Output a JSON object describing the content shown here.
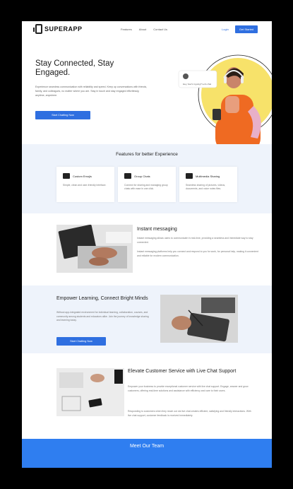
{
  "nav": {
    "logo": "SUPERAPP",
    "links": [
      "Features",
      "About",
      "Contact Us"
    ],
    "login": "Login",
    "signup": "Get Started"
  },
  "hero": {
    "title": "Stay Connected, Stay Engaged.",
    "description": "Experience seamless communication with reliability and speed. Keep up conversations with friends, family, and colleagues, no matter where you are. Stay in touch and stay engaged effortlessly, anytime, anywhere.",
    "button": "Start Chatting Now",
    "chat_bubble": "Hey, how's it going? Let's chat"
  },
  "features": {
    "title": "Features for better Experience",
    "cards": [
      {
        "title": "Custom Emojis",
        "text": "Simple, clean and user-friendly interface."
      },
      {
        "title": "Group Chats",
        "text": "Connect for sharing and managing group chats with ease in one click."
      },
      {
        "title": "Multimedia Sharing",
        "text": "Seamless sharing of pictures, videos, documents, and voice notes files."
      }
    ]
  },
  "instant": {
    "title": "Instant messaging",
    "text1": "Instant messaging allows users to communicate in real-time, providing a seamless and immediate way to stay connected.",
    "text2": "Instant messaging platforms help you connect and respond to you for work, for personal help, making it convenient and reliable for modern communication."
  },
  "learning": {
    "title": "Empower Learning, Connect Bright Minds",
    "text": "Without app-integrated environment for individual learning, collaboration, courses, and community among students and educators alike. Join the journey of knowledge sharing and learning today.",
    "button": "Start Chatting Now"
  },
  "support": {
    "title": "Elevate Customer Service with Live Chat Support",
    "text1": "Empower your business to provide exceptional customer service with live chat support. Engage, answer and grow customers, offering real-time solutions and assistance with efficiency and care to their users.",
    "text2": "Responding to customers when they reach out via live chat creates efficient, satisfying and friendly interactions. With live chat support, customer feedback is received immediately."
  },
  "team": {
    "title": "Meet Our Team"
  },
  "colors": {
    "accent": "#2f6fe0",
    "section_bg": "#eef3fb",
    "hero_circle": "#f7e26a"
  }
}
